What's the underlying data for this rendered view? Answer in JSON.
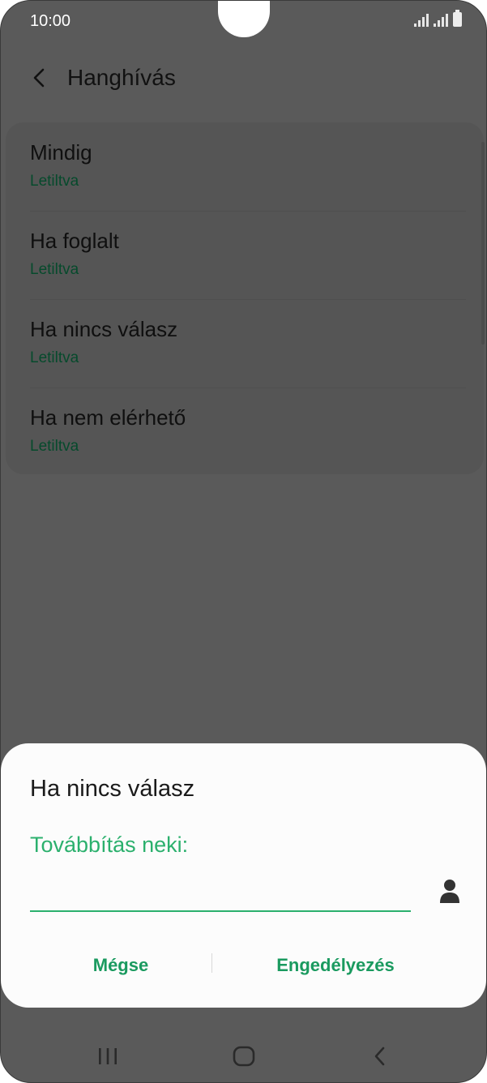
{
  "status_bar": {
    "time": "10:00",
    "signal_icon": "signal-icon",
    "battery_icon": "battery-icon"
  },
  "header": {
    "back_icon": "chevron-left-icon",
    "title": "Hanghívás"
  },
  "list": {
    "items": [
      {
        "label": "Mindig",
        "status": "Letiltva"
      },
      {
        "label": "Ha foglalt",
        "status": "Letiltva"
      },
      {
        "label": "Ha nincs válasz",
        "status": "Letiltva"
      },
      {
        "label": "Ha nem elérhető",
        "status": "Letiltva"
      }
    ]
  },
  "dialog": {
    "title": "Ha nincs válasz",
    "field_label": "Továbbítás neki:",
    "field_value": "",
    "contact_icon": "person-icon",
    "cancel_label": "Mégse",
    "confirm_label": "Engedélyezés"
  },
  "navbar": {
    "recents_icon": "recents-icon",
    "home_icon": "home-icon",
    "back_icon": "back-icon"
  },
  "colors": {
    "accent": "#2bb06d",
    "scrim": "#5a5a5a",
    "status_text": "#064a2c"
  }
}
